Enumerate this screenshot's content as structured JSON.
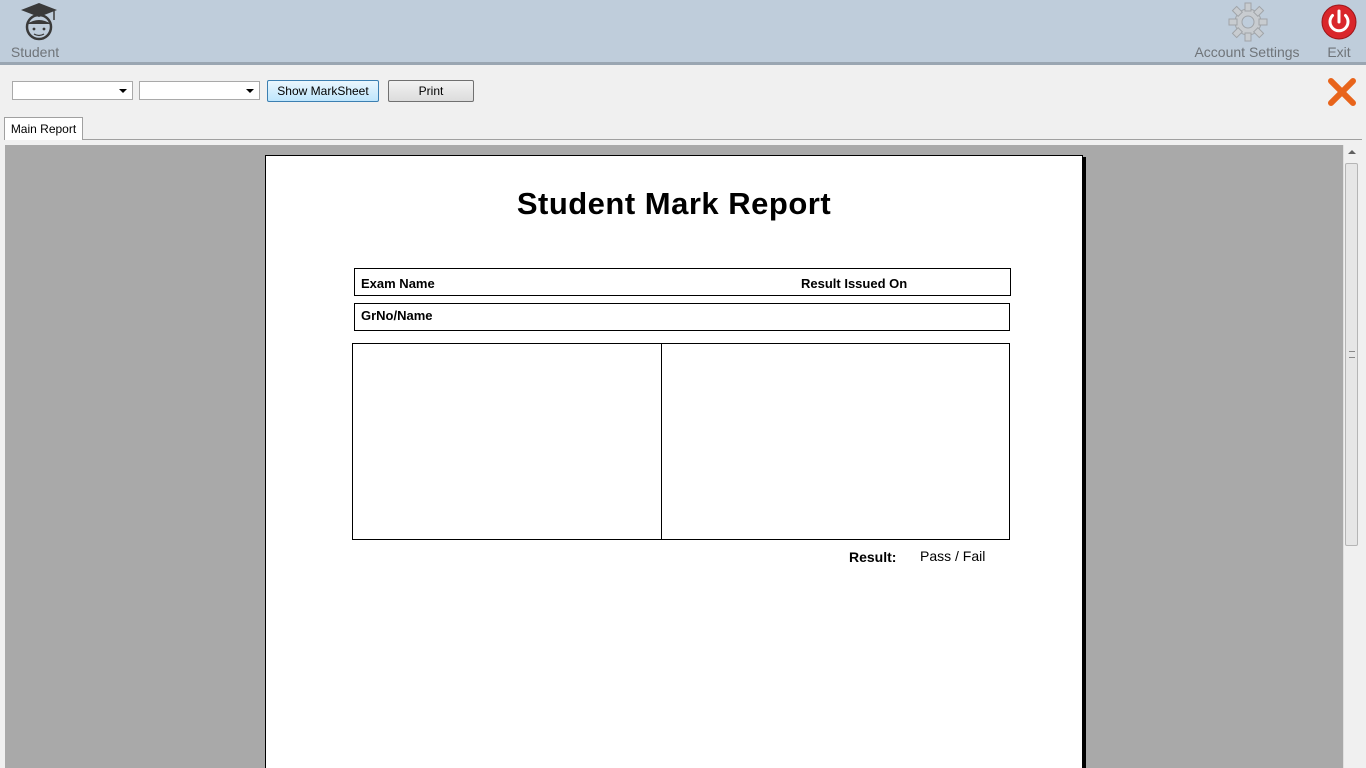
{
  "header": {
    "student_label": "Student",
    "account_settings_label": "Account Settings",
    "exit_label": "Exit"
  },
  "toolbar": {
    "combo1_value": "",
    "combo2_value": "",
    "show_marksheet_label": "Show MarkSheet",
    "print_label": "Print"
  },
  "tabs": [
    {
      "label": "Main Report"
    }
  ],
  "report": {
    "title": "Student Mark Report",
    "exam_name_label": "Exam Name",
    "result_issued_label": "Result Issued On",
    "grno_label": "GrNo/Name",
    "result_label": "Result:",
    "result_value": "Pass  /  Fail"
  },
  "colors": {
    "header_bg": "#bfcddb",
    "close_icon": "#e8641b",
    "exit_icon": "#d9262b"
  }
}
